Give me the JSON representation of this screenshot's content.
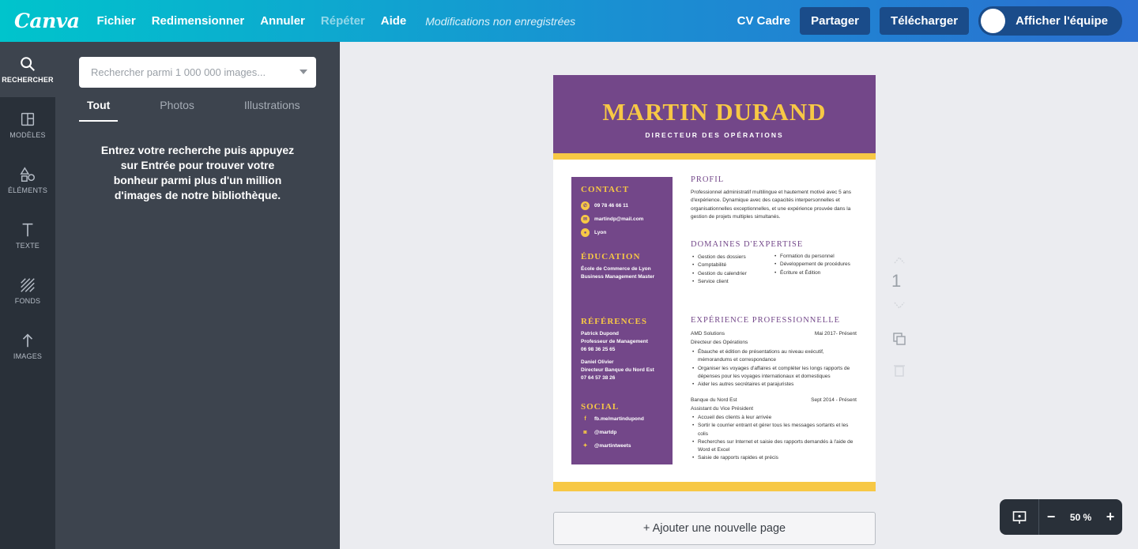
{
  "topbar": {
    "logo": "Canva",
    "menu": [
      {
        "label": "Fichier"
      },
      {
        "label": "Redimensionner"
      },
      {
        "label": "Annuler"
      },
      {
        "label": "Répéter"
      },
      {
        "label": "Aide"
      }
    ],
    "status": "Modifications non enregistrées",
    "doc_title": "CV Cadre",
    "share_label": "Partager",
    "download_label": "Télécharger",
    "team_label": "Afficher l'équipe"
  },
  "leftnav": [
    {
      "label": "RECHERCHER",
      "icon": "search-icon"
    },
    {
      "label": "MODÈLES",
      "icon": "layout-icon"
    },
    {
      "label": "ÉLÉMENTS",
      "icon": "shapes-icon"
    },
    {
      "label": "TEXTE",
      "icon": "text-icon"
    },
    {
      "label": "FONDS",
      "icon": "background-icon"
    },
    {
      "label": "IMAGES",
      "icon": "upload-icon"
    }
  ],
  "panel": {
    "search_placeholder": "Rechercher parmi 1 000 000 images...",
    "tabs": [
      {
        "label": "Tout"
      },
      {
        "label": "Photos"
      },
      {
        "label": "Illustrations"
      }
    ],
    "help_text": "Entrez votre recherche puis appuyez sur Entrée pour trouver votre bonheur parmi plus d'un million d'images de notre bibliothèque."
  },
  "resume": {
    "name": "MARTIN DURAND",
    "role": "DIRECTEUR DES OPÉRATIONS",
    "contact": {
      "heading": "CONTACT",
      "phone": "09 78 46 66 11",
      "email": "martindp@mail.com",
      "city": "Lyon"
    },
    "education": {
      "heading": "ÉDUCATION",
      "line1": "École de Commerce de Lyon",
      "line2": "Business Management Master"
    },
    "references": {
      "heading": "RÉFÉRENCES",
      "ref1_name": "Patrick Dupond",
      "ref1_title": "Professeur de Management",
      "ref1_phone": "06 98 36 25 65",
      "ref2_name": "Daniel Olivier",
      "ref2_title": "Directeur Banque du Nord Est",
      "ref2_phone": "07 64 57 38 26"
    },
    "social": {
      "heading": "SOCIAL",
      "facebook": "fb.me/martindupond",
      "instagram": "@martdp",
      "twitter": "@martintweets"
    },
    "profile": {
      "heading": "PROFIL",
      "text": "Professionnel administratif multilingue et hautement motivé avec 5 ans d'expérience. Dynamique avec des capacités interpersonnelles et organisationnelles exceptionnelles, et une expérience prouvée dans la gestion de projets multiples simultanés."
    },
    "expertise": {
      "heading": "DOMAINES D'EXPERTISE",
      "col1": [
        "Gestion des dossiers",
        "Comptabilité",
        "Gestion du calendrier",
        "Service client"
      ],
      "col2": [
        "Formation du personnel",
        "Développement de procédures",
        "Écriture et Édition"
      ]
    },
    "experience": {
      "heading": "EXPÉRIENCE PROFESSIONNELLE",
      "job1_company": "AMD Solutions",
      "job1_dates": "Mai 2017- Présent",
      "job1_title": "Directeur des Opérations",
      "job1_bullets": [
        "Ébauche et édition de présentations au niveau exécutif, mémorandums et correspondance",
        "Organiser les voyages d'affaires et compléter les longs rapports de dépenses pour les voyages internationaux et domestiques",
        "Aider les autres secrétaires et parajuristes"
      ],
      "job2_company": "Banque du Nord Est",
      "job2_dates": "Sept 2014 - Présent",
      "job2_title": "Assistant du Vice Président",
      "job2_bullets": [
        "Accueil des clients  à leur arrivée",
        "Sortir le courrier entrant et gérer tous les messages sortants et les colis",
        "Recherches sur Internet et saisie des rapports demandés à l'aide de Word et Excel",
        "Saisie de rapports rapides et précis"
      ]
    }
  },
  "canvas": {
    "page_number": "1",
    "add_page_label": "+ Ajouter une nouvelle page"
  },
  "zoom": {
    "value": "50 %",
    "minus": "−",
    "plus": "+"
  },
  "colors": {
    "resume_purple": "#734789",
    "resume_yellow": "#f7c845",
    "topbar_start": "#00c4cc",
    "topbar_end": "#2b6fd1"
  }
}
